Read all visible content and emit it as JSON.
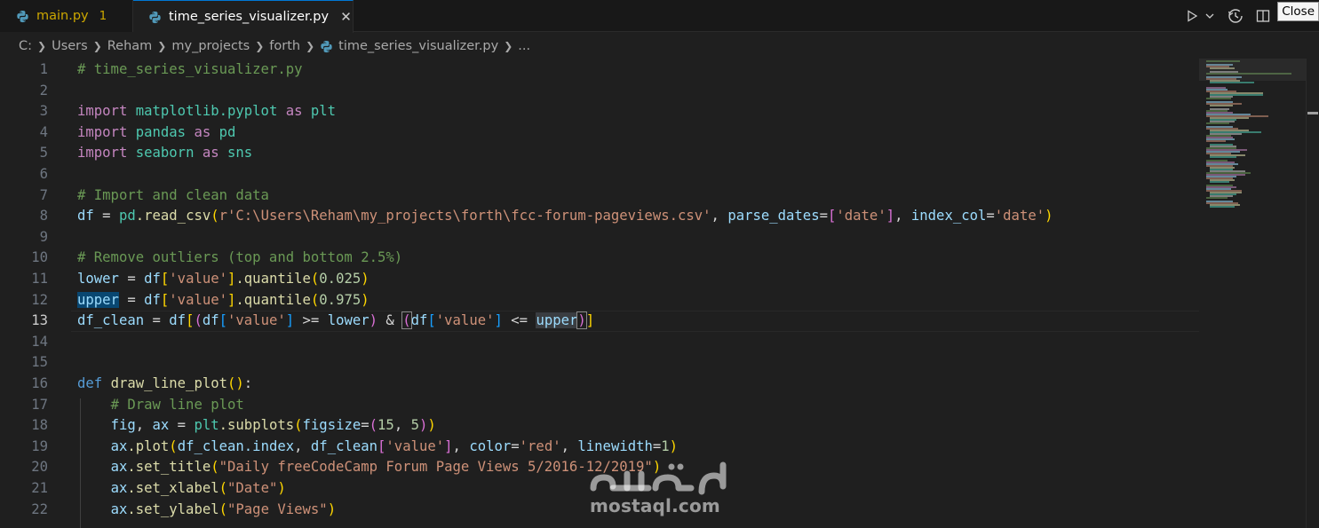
{
  "tabs": [
    {
      "label": "main.py",
      "problems": "1",
      "active": false
    },
    {
      "label": "time_series_visualizer.py",
      "active": true
    }
  ],
  "tooltip": "Close",
  "breadcrumb": [
    "C:",
    "Users",
    "Reham",
    "my_projects",
    "forth",
    "time_series_visualizer.py",
    "..."
  ],
  "editor": {
    "current_line": 13,
    "lines": [
      {
        "n": "1"
      },
      {
        "n": "2"
      },
      {
        "n": "3"
      },
      {
        "n": "4"
      },
      {
        "n": "5"
      },
      {
        "n": "6"
      },
      {
        "n": "7"
      },
      {
        "n": "8"
      },
      {
        "n": "9"
      },
      {
        "n": "10"
      },
      {
        "n": "11"
      },
      {
        "n": "12"
      },
      {
        "n": "13"
      },
      {
        "n": "14"
      },
      {
        "n": "15"
      },
      {
        "n": "16"
      },
      {
        "n": "17"
      },
      {
        "n": "18"
      },
      {
        "n": "19"
      },
      {
        "n": "20"
      },
      {
        "n": "21"
      },
      {
        "n": "22"
      }
    ],
    "code": {
      "l1": "# time_series_visualizer.py",
      "l3_kw": "import",
      "l3_mod": "matplotlib.pyplot",
      "l3_as": "as",
      "l3_alias": "plt",
      "l4_kw": "import",
      "l4_mod": "pandas",
      "l4_as": "as",
      "l4_alias": "pd",
      "l5_kw": "import",
      "l5_mod": "seaborn",
      "l5_as": "as",
      "l5_alias": "sns",
      "l7": "# Import and clean data",
      "l8_df": "df",
      "l8_eq": " = ",
      "l8_pd": "pd",
      "l8_fn": ".read_csv",
      "l8_str": "r'C:\\Users\\Reham\\my_projects\\forth\\fcc-forum-pageviews.csv'",
      "l8_k1": "parse_dates",
      "l8_s1": "'date'",
      "l8_k2": "index_col",
      "l8_s2": "'date'",
      "l10": "# Remove outliers (top and bottom 2.5%)",
      "l11_v": "lower",
      "l11_df": "df",
      "l11_s": "'value'",
      "l11_fn": ".quantile",
      "l11_n": "0.025",
      "l12_v": "upper",
      "l12_df": "df",
      "l12_s": "'value'",
      "l12_fn": ".quantile",
      "l12_n": "0.975",
      "l13_v": "df_clean",
      "l13_df": "df",
      "l13_df2": "df",
      "l13_s": "'value'",
      "l13_lower": "lower",
      "l13_df3": "df",
      "l13_s2": "'value'",
      "l13_upper": "upper",
      "l16_def": "def",
      "l16_fn": "draw_line_plot",
      "l17": "# Draw line plot",
      "l18_fig": "fig",
      "l18_ax": "ax",
      "l18_plt": "plt",
      "l18_fn": ".subplots",
      "l18_k": "figsize",
      "l18_n1": "15",
      "l18_n2": "5",
      "l19_ax": "ax",
      "l19_fn": ".plot",
      "l19_dfc": "df_clean",
      "l19_idx": ".index",
      "l19_dfc2": "df_clean",
      "l19_s": "'value'",
      "l19_k1": "color",
      "l19_s2": "'red'",
      "l19_k2": "linewidth",
      "l19_n": "1",
      "l20_ax": "ax",
      "l20_fn": ".set_title",
      "l20_s": "\"Daily freeCodeCamp Forum Page Views 5/2016-12/2019\"",
      "l21_ax": "ax",
      "l21_fn": ".set_xlabel",
      "l21_s": "\"Date\"",
      "l22_ax": "ax",
      "l22_fn": ".set_ylabel",
      "l22_s": "\"Page Views\""
    }
  },
  "watermark": {
    "text": "mostaql.com"
  },
  "colors": {
    "accent": "#0078d4",
    "warning": "#cca700",
    "background": "#1f1f1f"
  }
}
